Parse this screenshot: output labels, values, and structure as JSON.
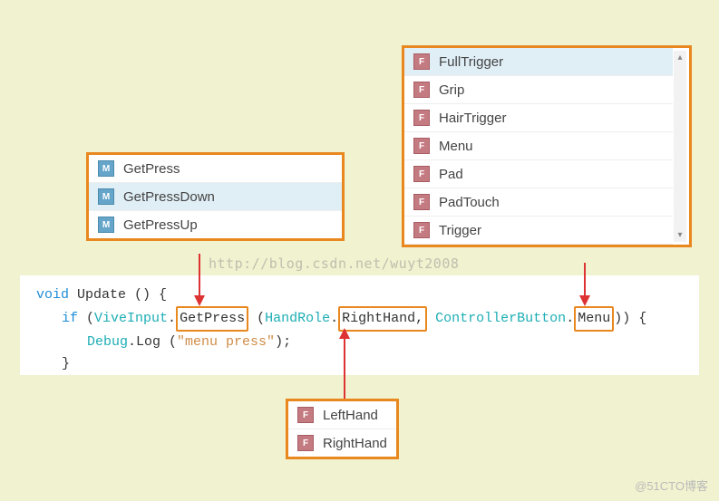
{
  "methodsPopup": {
    "items": [
      "GetPress",
      "GetPressDown",
      "GetPressUp"
    ],
    "selected": "GetPressDown"
  },
  "buttonsPopup": {
    "items": [
      "FullTrigger",
      "Grip",
      "HairTrigger",
      "Menu",
      "Pad",
      "PadTouch",
      "Trigger"
    ],
    "selected": "FullTrigger"
  },
  "handsPopup": {
    "items": [
      "LeftHand",
      "RightHand"
    ]
  },
  "code": {
    "line1_kw": "void",
    "line1_fn": " Update () {",
    "line2_kw": "if",
    "line2_open": " (",
    "line2_cls1": "ViveInput",
    "line2_dot1": ".",
    "line2_method": "GetPress",
    "line2_open2": " (",
    "line2_cls2": "HandRole",
    "line2_dot2": ".",
    "line2_hand": "RightHand,",
    "line2_sp": " ",
    "line2_cls3": "ControllerButton",
    "line2_dot3": ".",
    "line2_btn": "Menu",
    "line2_close": ")) {",
    "line3_cls": "Debug",
    "line3_dot": ".Log (",
    "line3_str": "\"menu press\"",
    "line3_close": ");",
    "line4": "}"
  },
  "watermark": "@51CTO博客",
  "url_watermark": "http://blog.csdn.net/wuyt2008"
}
